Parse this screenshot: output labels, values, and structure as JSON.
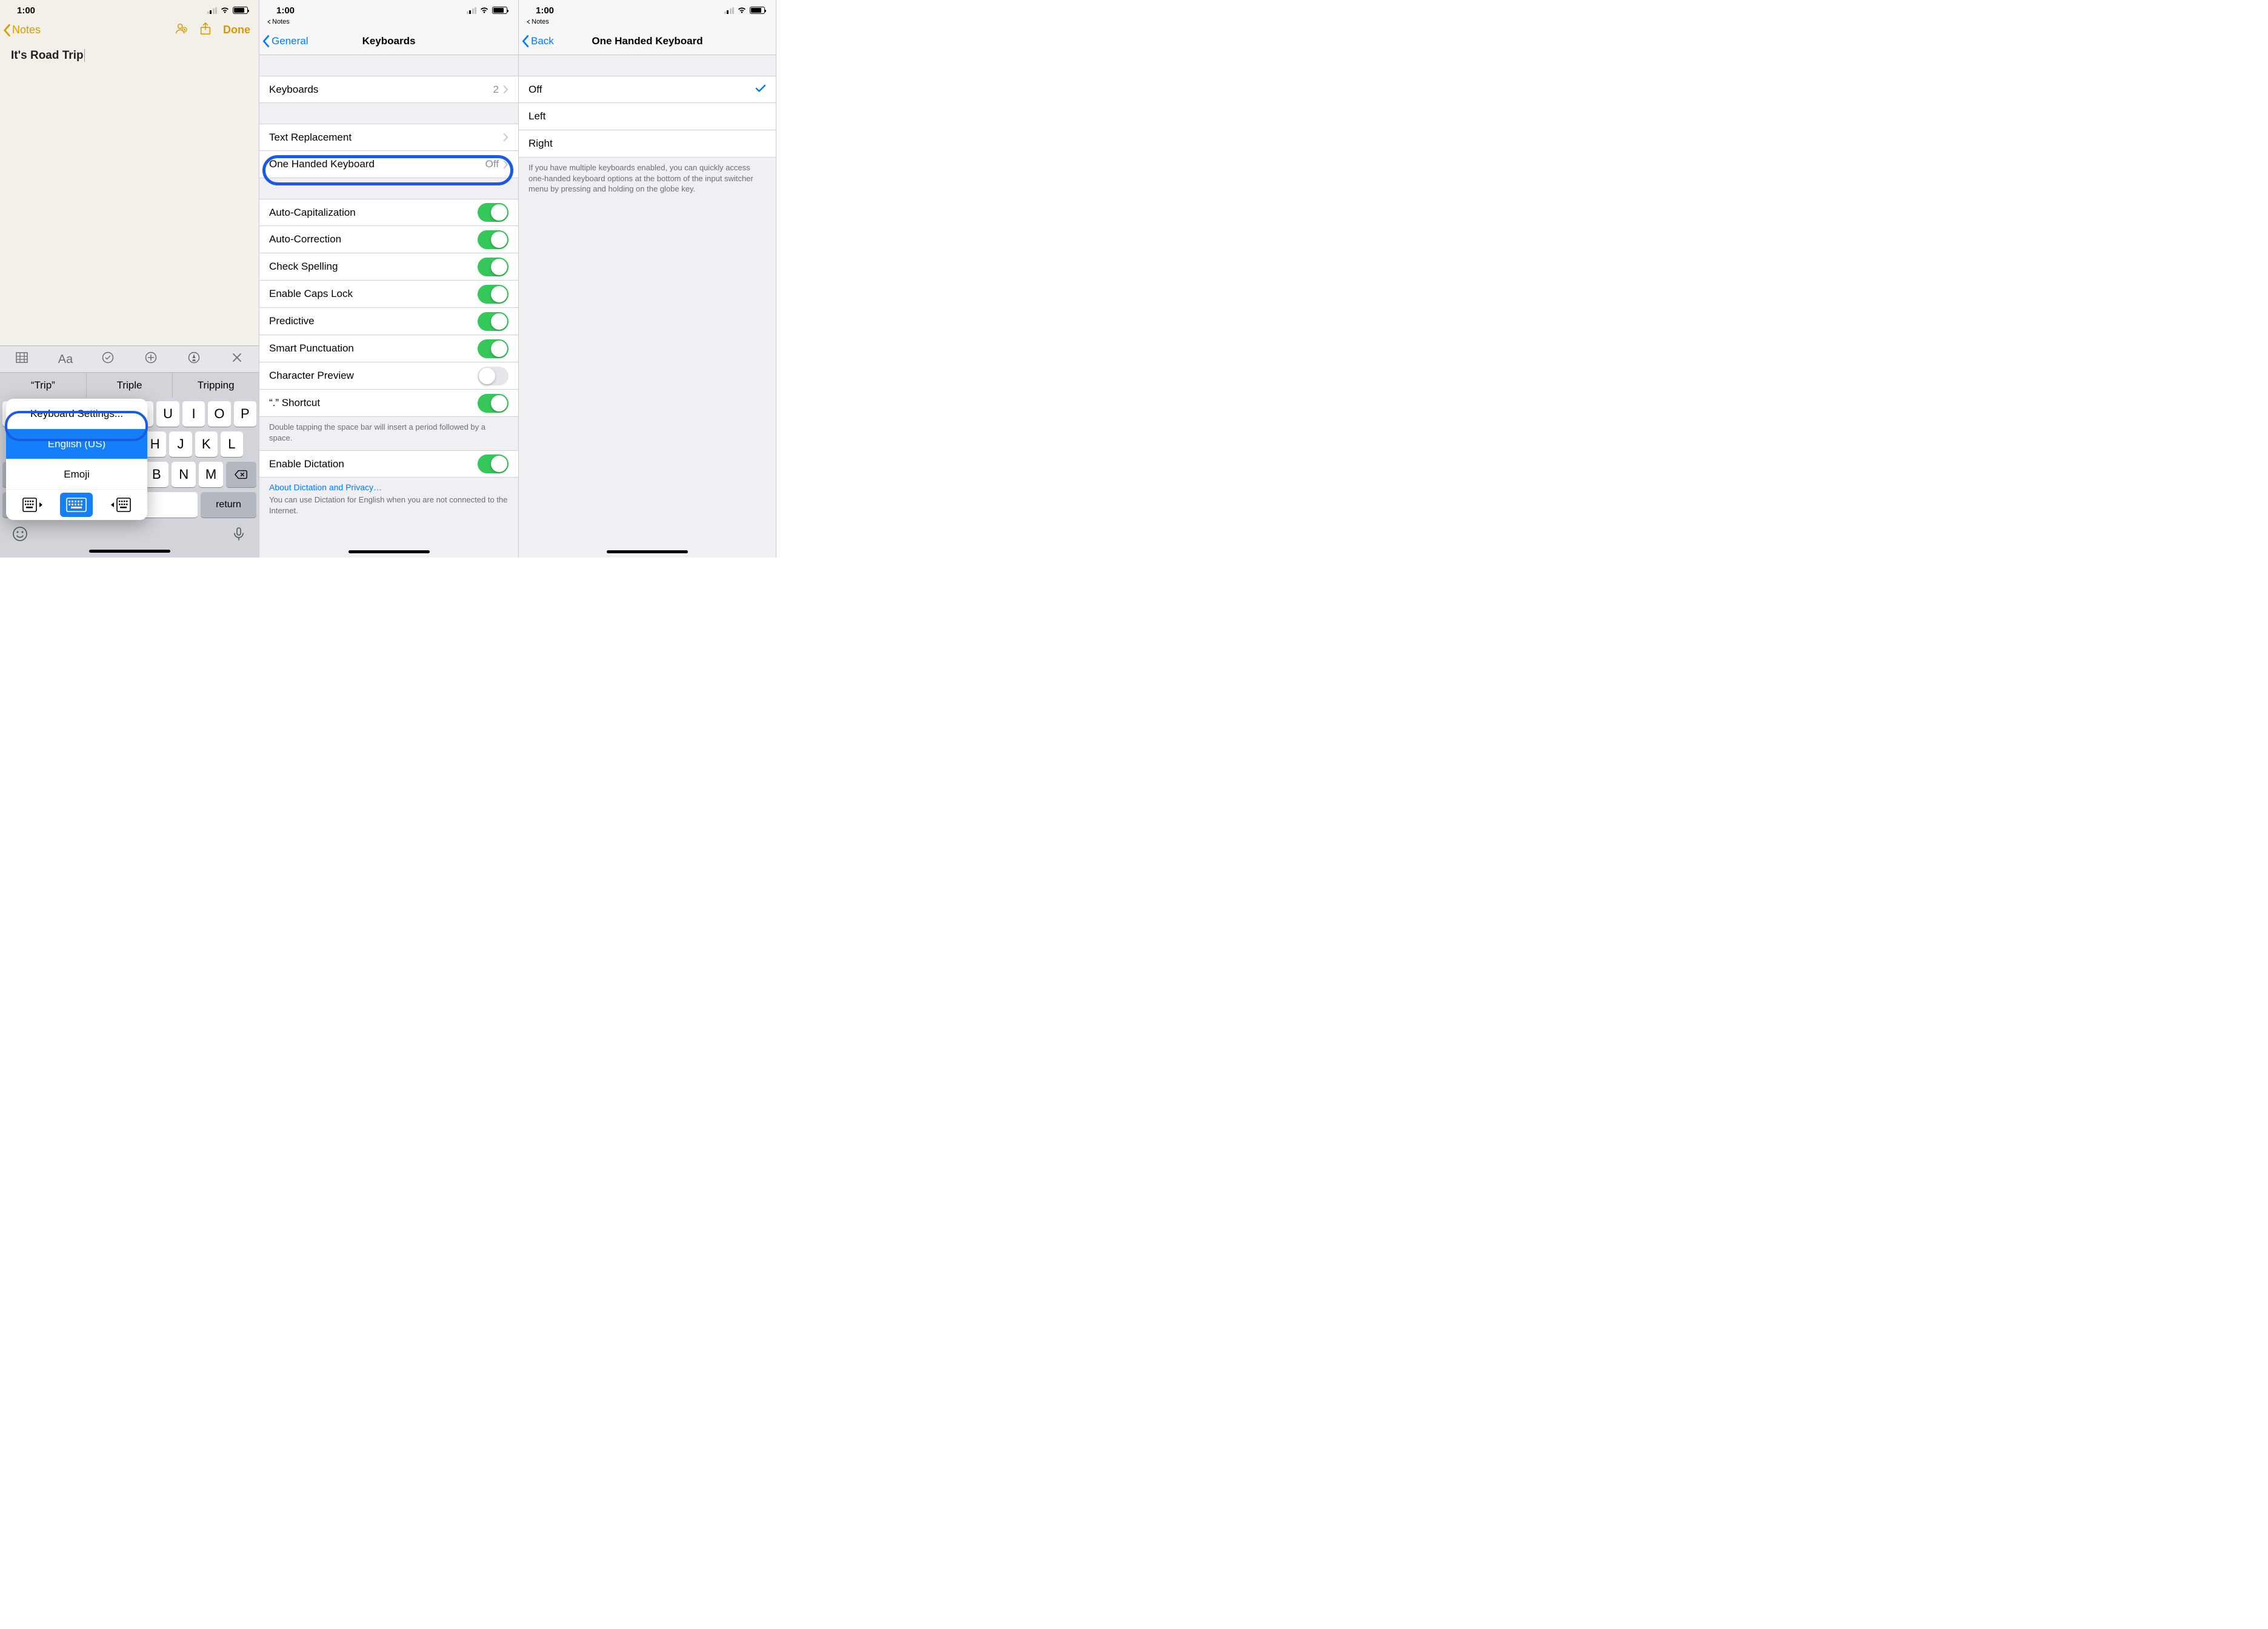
{
  "status": {
    "time": "1:00"
  },
  "panel1": {
    "back_label": "Notes",
    "done": "Done",
    "title_text": "It's Road Trip",
    "suggestions": [
      "“Trip”",
      "Triple",
      "Tripping"
    ],
    "popover": {
      "settings": "Keyboard Settings...",
      "english": "English (US)",
      "emoji": "Emoji"
    },
    "return_label": "return"
  },
  "panel2": {
    "breadcrumb": "Notes",
    "back": "General",
    "title": "Keyboards",
    "keyboards_row": {
      "label": "Keyboards",
      "count": "2"
    },
    "text_replacement": "Text Replacement",
    "one_handed": {
      "label": "One Handed Keyboard",
      "value": "Off"
    },
    "toggles": {
      "auto_cap": "Auto-Capitalization",
      "auto_corr": "Auto-Correction",
      "check_spell": "Check Spelling",
      "caps_lock": "Enable Caps Lock",
      "predictive": "Predictive",
      "smart_punc": "Smart Punctuation",
      "char_preview": "Character Preview",
      "shortcut": "“.” Shortcut"
    },
    "shortcut_footer": "Double tapping the space bar will insert a period followed by a space.",
    "dictation": "Enable Dictation",
    "dictation_link": "About Dictation and Privacy…",
    "dictation_footer": "You can use Dictation for English when you are not connected to the Internet."
  },
  "panel3": {
    "breadcrumb": "Notes",
    "back": "Back",
    "title": "One Handed Keyboard",
    "options": {
      "off": "Off",
      "left": "Left",
      "right": "Right"
    },
    "footer": "If you have multiple keyboards enabled, you can quickly access one-handed keyboard options at the bottom of the input switcher menu by pressing and holding on the globe key."
  }
}
